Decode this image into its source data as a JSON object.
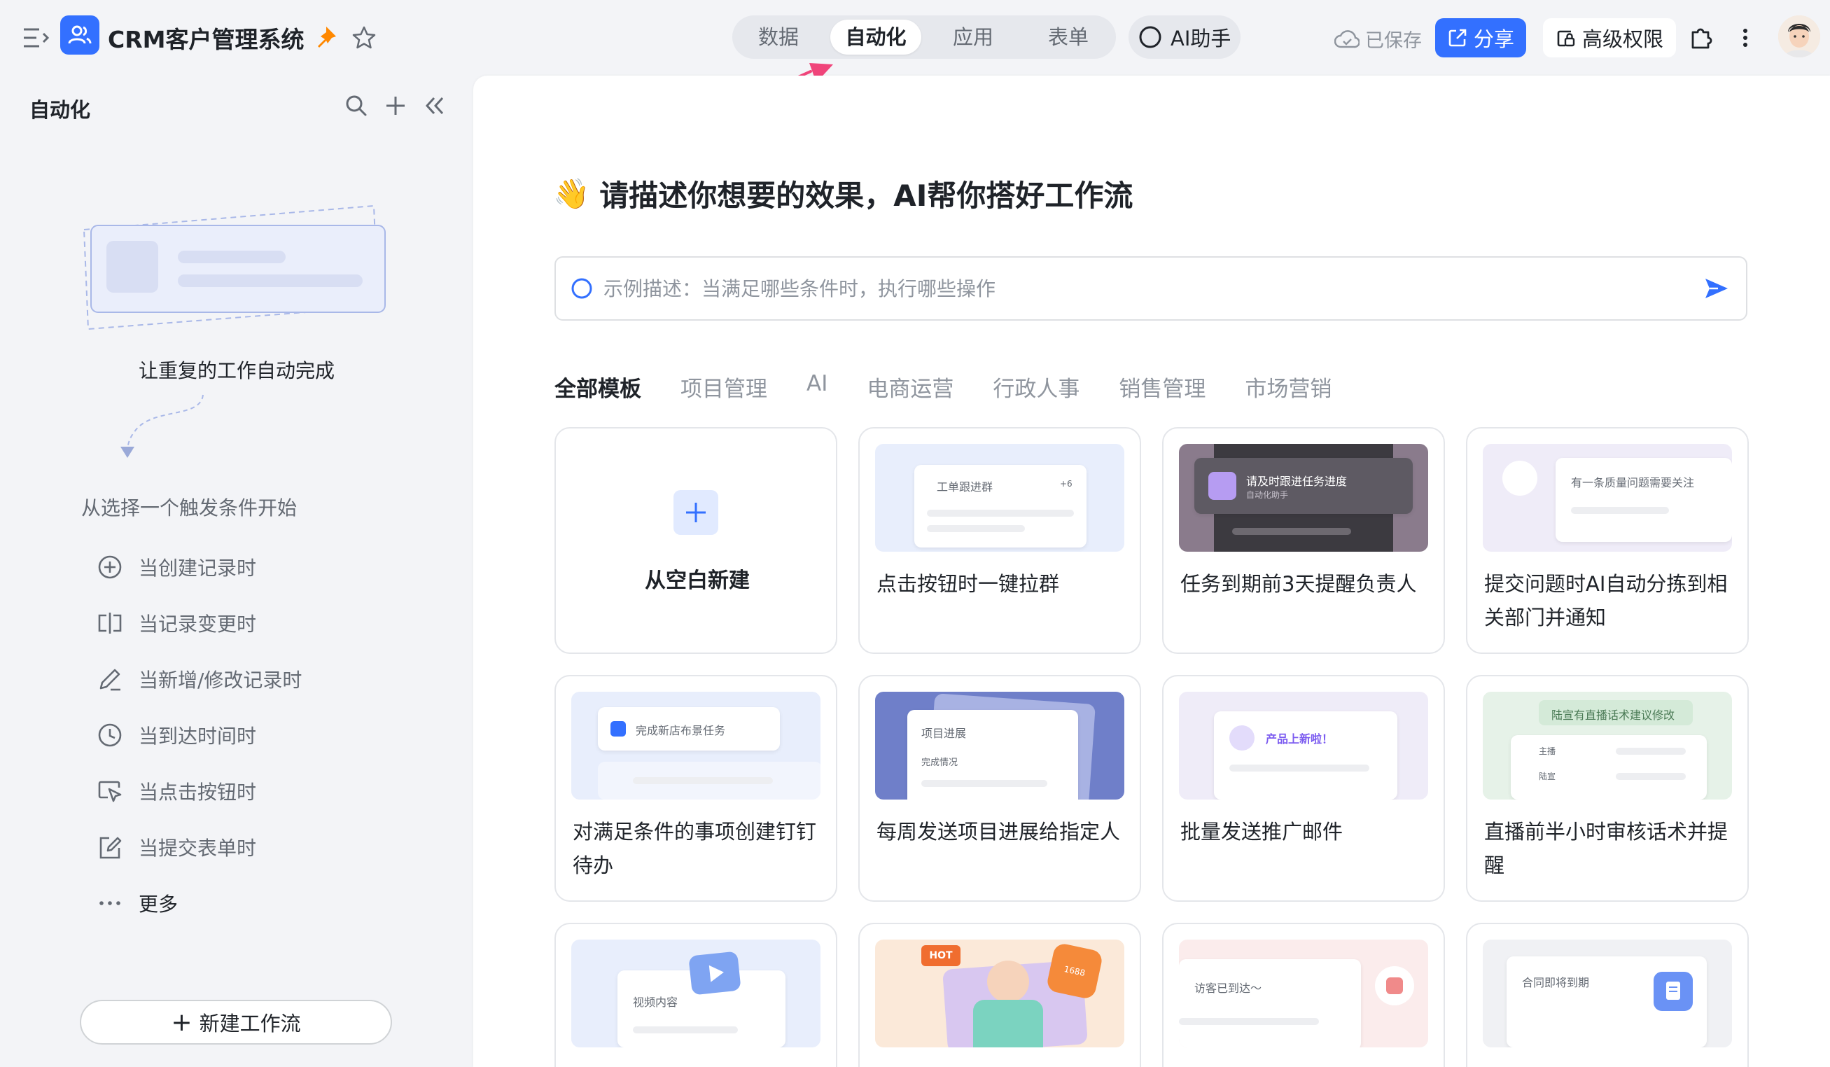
{
  "app": {
    "title": "CRM客户管理系统"
  },
  "nav": {
    "tabs": [
      {
        "label": "数据",
        "active": false
      },
      {
        "label": "自动化",
        "active": true
      },
      {
        "label": "应用",
        "active": false
      },
      {
        "label": "表单",
        "active": false
      }
    ],
    "ai_assistant": "AI助手"
  },
  "header": {
    "saved_label": "已保存",
    "share_label": "分享",
    "permission_label": "高级权限"
  },
  "sidebar": {
    "title": "自动化",
    "caption": "让重复的工作自动完成",
    "subtitle": "从选择一个触发条件开始",
    "triggers": [
      {
        "label": "当创建记录时",
        "icon": "plus-circle-icon"
      },
      {
        "label": "当记录变更时",
        "icon": "text-cursor-icon"
      },
      {
        "label": "当新增/修改记录时",
        "icon": "pencil-icon"
      },
      {
        "label": "当到达时间时",
        "icon": "clock-icon"
      },
      {
        "label": "当点击按钮时",
        "icon": "cursor-click-icon"
      },
      {
        "label": "当提交表单时",
        "icon": "form-edit-icon"
      },
      {
        "label": "更多",
        "icon": "ellipsis-icon"
      }
    ],
    "new_workflow": "新建工作流"
  },
  "main": {
    "headline_emoji": "👋",
    "headline": "请描述你想要的效果，AI帮你搭好工作流",
    "prompt_placeholder": "示例描述：当满足哪些条件时，执行哪些操作",
    "template_tabs": [
      "全部模板",
      "项目管理",
      "AI",
      "电商运营",
      "行政人事",
      "销售管理",
      "市场营销"
    ],
    "blank_card": "从空白新建",
    "cards": [
      {
        "title": "点击按钮时一键拉群",
        "thumb_text": "工单跟进群",
        "thumb_badge": "+6"
      },
      {
        "title": "任务到期前3天提醒负责人",
        "thumb_text": "请及时跟进任务进度",
        "thumb_sub": "自动化助手"
      },
      {
        "title": "提交问题时AI自动分拣到相关部门并通知",
        "thumb_text": "有一条质量问题需要关注"
      },
      {
        "title": "对满足条件的事项创建钉钉待办",
        "thumb_text": "完成新店布景任务"
      },
      {
        "title": "每周发送项目进展给指定人",
        "thumb_text": "项目进展",
        "thumb_sub": "完成情况"
      },
      {
        "title": "批量发送推广邮件",
        "thumb_text": "产品上新啦！"
      },
      {
        "title": "直播前半小时审核话术并提醒",
        "thumb_text": "陆宣有直播话术建议修改",
        "thumb_row1": "主播",
        "thumb_row2": "陆宣"
      },
      {
        "title": "",
        "thumb_text": "视频内容"
      },
      {
        "title": "",
        "thumb_text": "HOT",
        "thumb_badge": "1688"
      },
      {
        "title": "",
        "thumb_text": "访客已到达～"
      },
      {
        "title": "",
        "thumb_text": "合同即将到期"
      }
    ]
  },
  "colors": {
    "accent": "#3370ff",
    "pin": "#ff8800",
    "arrow": "#f0447a"
  }
}
